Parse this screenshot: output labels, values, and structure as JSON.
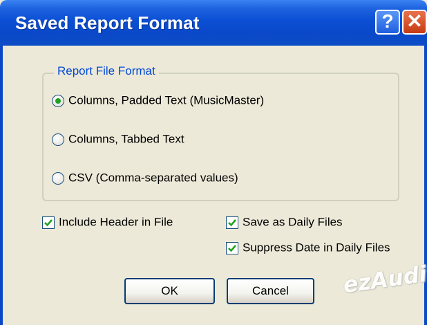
{
  "window": {
    "title": "Saved Report Format",
    "help_label": "?",
    "close_label": "✕"
  },
  "group": {
    "legend": "Report File Format",
    "options": [
      {
        "label": "Columns, Padded Text (MusicMaster)",
        "selected": true
      },
      {
        "label": "Columns, Tabbed Text",
        "selected": false
      },
      {
        "label": "CSV (Comma-separated values)",
        "selected": false
      }
    ]
  },
  "checkboxes": {
    "include_header": {
      "label": "Include Header in File",
      "checked": true
    },
    "save_daily": {
      "label": "Save as Daily Files",
      "checked": true
    },
    "suppress_date": {
      "label": "Suppress Date in Daily Files",
      "checked": true
    }
  },
  "buttons": {
    "ok_label": "OK",
    "cancel_label": "Cancel"
  },
  "watermark": "ezAudit",
  "colors": {
    "titlebar": "#0a48c8",
    "dialog_bg": "#ece9d8",
    "legend_text": "#0046d5",
    "radio_dot": "#21a121",
    "check_mark": "#21a121"
  },
  "icons": {
    "help": "help-icon",
    "close": "close-icon",
    "radio": "radio-icon",
    "checkbox": "checkbox-icon"
  }
}
